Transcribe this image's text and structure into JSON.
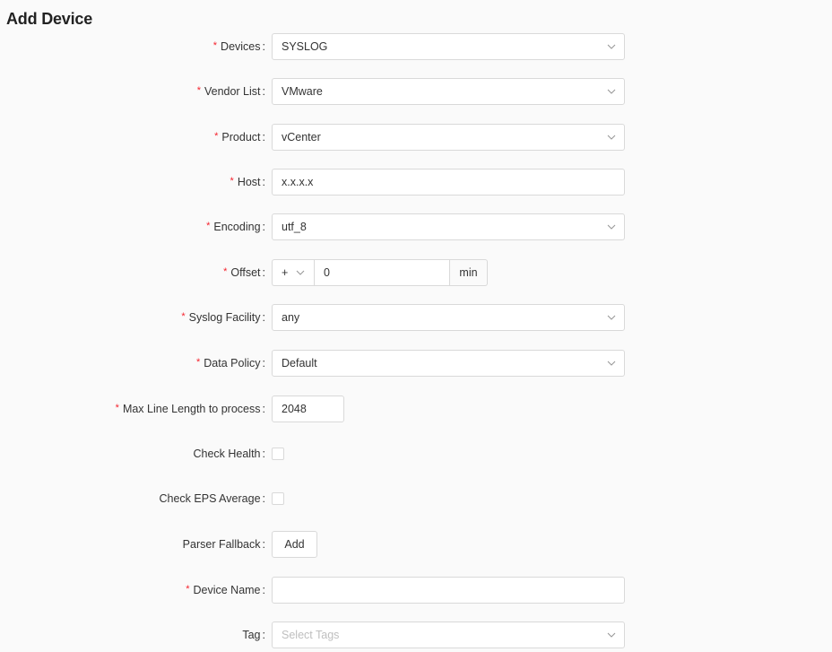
{
  "page": {
    "title": "Add Device"
  },
  "form": {
    "devices": {
      "label": "Devices",
      "value": "SYSLOG"
    },
    "vendor_list": {
      "label": "Vendor List",
      "value": "VMware"
    },
    "product": {
      "label": "Product",
      "value": "vCenter"
    },
    "host": {
      "label": "Host",
      "value": "x.x.x.x"
    },
    "encoding": {
      "label": "Encoding",
      "value": "utf_8"
    },
    "offset": {
      "label": "Offset",
      "sign": "+",
      "value": "0",
      "unit": "min"
    },
    "syslog_facility": {
      "label": "Syslog Facility",
      "value": "any"
    },
    "data_policy": {
      "label": "Data Policy",
      "value": "Default"
    },
    "max_line_length": {
      "label": "Max Line Length to process",
      "value": "2048"
    },
    "check_health": {
      "label": "Check Health",
      "checked": false
    },
    "check_eps_average": {
      "label": "Check EPS Average",
      "checked": false
    },
    "parser_fallback": {
      "label": "Parser Fallback",
      "button_label": "Add"
    },
    "device_name": {
      "label": "Device Name",
      "value": ""
    },
    "tag": {
      "label": "Tag",
      "placeholder": "Select Tags"
    }
  },
  "colors": {
    "required_marker": "#f5222d",
    "border": "#d9d9d9",
    "background": "#fafafa"
  },
  "icons": {
    "select_arrow": "chevron-down-icon"
  }
}
